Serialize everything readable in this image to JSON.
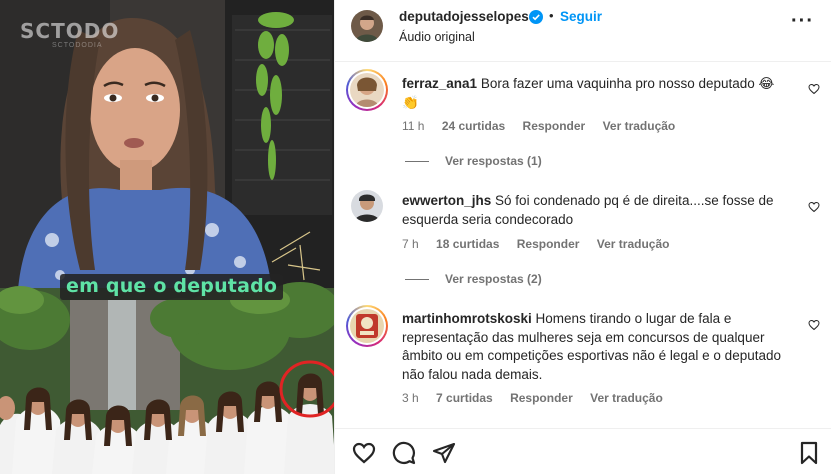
{
  "media": {
    "watermark": "SCTODO",
    "watermark_sub": "SCTODODIA",
    "caption": "em que o deputado"
  },
  "post": {
    "username": "deputadojesselopes",
    "follow_label": "Seguir",
    "separator": "•",
    "audio": "Áudio original"
  },
  "comments": [
    {
      "username": "ferraz_ana1",
      "text": "Bora fazer uma vaquinha pro nosso deputado 😂👏",
      "time": "11 h",
      "likes": "24 curtidas",
      "reply": "Responder",
      "translate": "Ver tradução",
      "view_replies": "Ver respostas (1)"
    },
    {
      "username": "ewwerton_jhs",
      "text": "Só foi condenado pq é de direita....se fosse de esquerda seria condecorado",
      "time": "7 h",
      "likes": "18 curtidas",
      "reply": "Responder",
      "translate": "Ver tradução",
      "view_replies": "Ver respostas (2)"
    },
    {
      "username": "martinhomrotskoski",
      "text": "Homens tirando o lugar de fala e representação das mulheres seja em concursos de qualquer âmbito ou em competições esportivas não é legal e o deputado não falou nada demais.",
      "time": "3 h",
      "likes": "7 curtidas",
      "reply": "Responder",
      "translate": "Ver tradução"
    }
  ],
  "colors": {
    "link_blue": "#0095f6",
    "caption_green": "#5fe3a6",
    "muted_text": "#737373",
    "highlight_circle": "#e02424"
  }
}
